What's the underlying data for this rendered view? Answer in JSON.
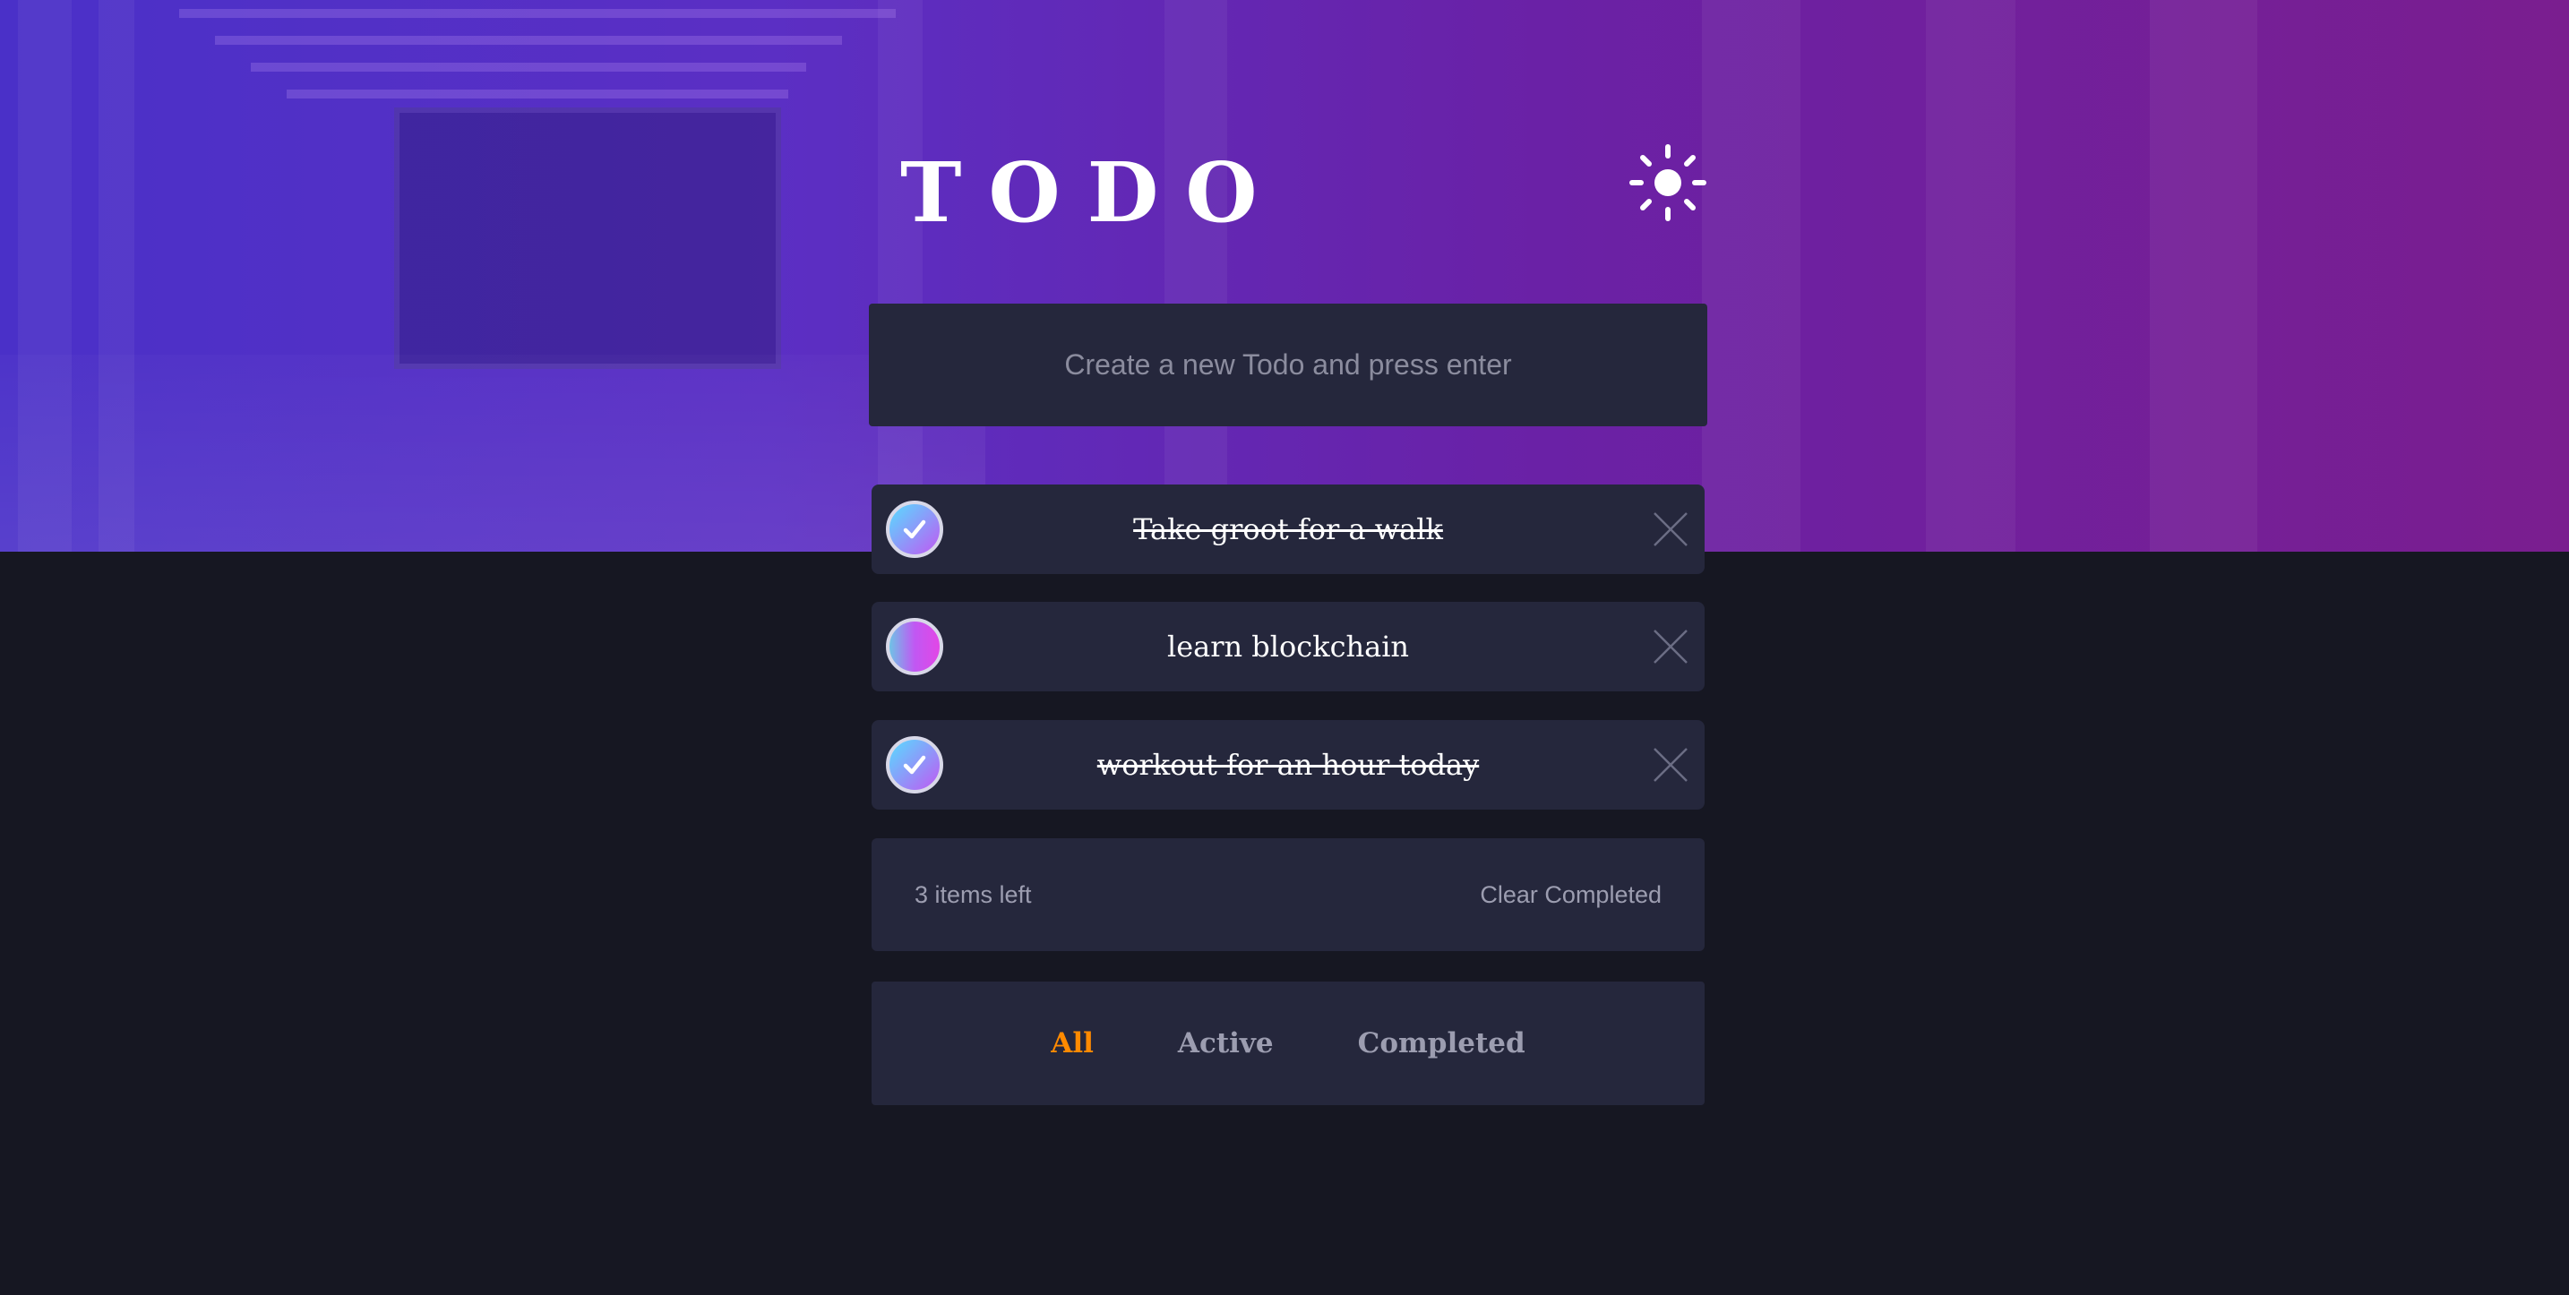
{
  "header": {
    "title": "TODO",
    "theme_toggle_icon": "sun-icon"
  },
  "new_todo": {
    "placeholder": "Create a new Todo and press enter",
    "value": ""
  },
  "todos": [
    {
      "text": "Take groot for a walk",
      "completed": true
    },
    {
      "text": "learn blockchain",
      "completed": false
    },
    {
      "text": "workout for an hour today",
      "completed": true
    }
  ],
  "footer": {
    "items_left": "3 items left",
    "clear_completed": "Clear Completed"
  },
  "filters": {
    "all": "All",
    "active": "Active",
    "completed": "Completed",
    "selected": "All"
  },
  "colors": {
    "accent": "#ff8a00",
    "card": "#25273c",
    "background": "#161722",
    "check_gradient_start": "#57ddff",
    "check_gradient_end": "#c058f3"
  }
}
